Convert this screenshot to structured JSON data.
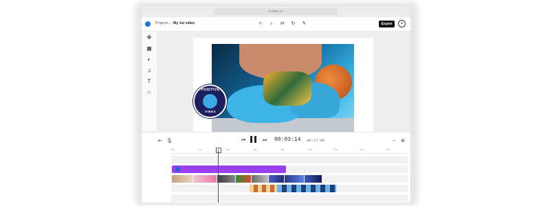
{
  "browser": {
    "url": "invideo.io"
  },
  "topbar": {
    "breadcrumb_projects": "Projects",
    "breadcrumb_sep": "/",
    "project_name": "My 1st video",
    "export_label": "Export"
  },
  "sticker": {
    "top_text": "POSITIVE",
    "bottom_text": "VIBES"
  },
  "timeline": {
    "current_time": "00:03:14",
    "total_time": "00:17:00",
    "ruler": [
      "0s",
      "2s",
      "4s",
      "6s",
      "8s",
      "10s",
      "12s",
      "14s",
      "16s"
    ]
  },
  "colors": {
    "accent": "#1f76d8",
    "audio_clip": "#9a3ff0",
    "export_button": "#111111"
  }
}
